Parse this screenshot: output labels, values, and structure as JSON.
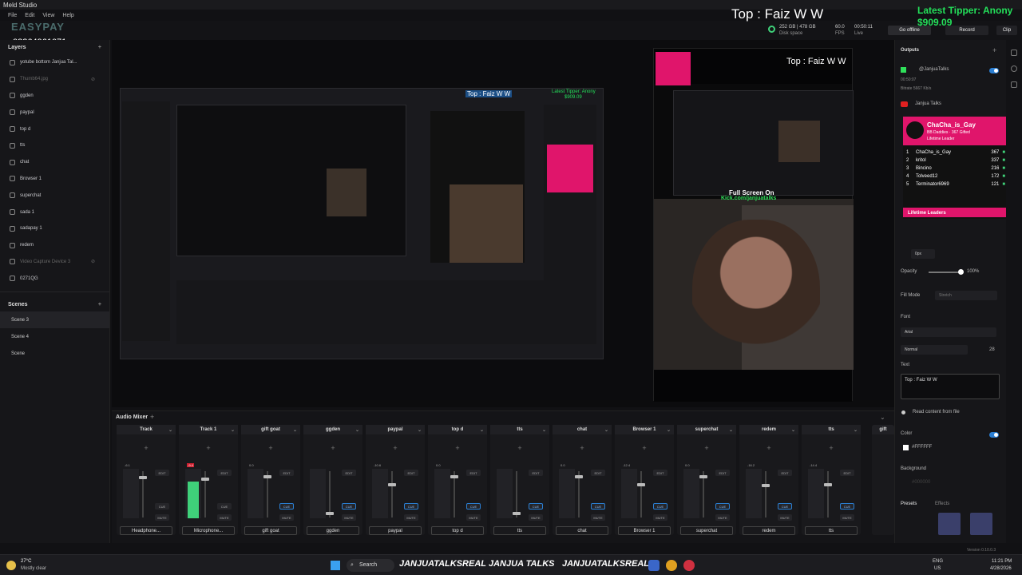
{
  "app": {
    "title": "Meld Studio",
    "menus": [
      "File",
      "Edit",
      "View",
      "Help"
    ],
    "phone": "03364961071",
    "logo": "EASYPAY"
  },
  "overlay": {
    "top_text": "Top : Faiz W W",
    "tipper_label": "Latest Tipper: Anony",
    "tipper_amount": "$909.09"
  },
  "topbar": {
    "disk": "252 GB | 478 GB",
    "disk_label": "Disk space",
    "fps": "60.0",
    "fps_label": "FPS",
    "time": "00:50:11",
    "time_label": "Live",
    "go_offline": "Go offline",
    "record": "Record",
    "clip": "Clip"
  },
  "layers": {
    "title": "Layers",
    "items": [
      {
        "name": "yotube bottom Janjua Tal...",
        "dim": false
      },
      {
        "name": "Thumb64.jpg",
        "dim": true
      },
      {
        "name": "ggden",
        "dim": false
      },
      {
        "name": "paypal",
        "dim": false
      },
      {
        "name": "top d",
        "dim": false
      },
      {
        "name": "tts",
        "dim": false
      },
      {
        "name": "chat",
        "dim": false
      },
      {
        "name": "Browser 1",
        "dim": false
      },
      {
        "name": "superchat",
        "dim": false
      },
      {
        "name": "sada 1",
        "dim": false
      },
      {
        "name": "sadapay 1",
        "dim": false
      },
      {
        "name": "redem",
        "dim": false
      },
      {
        "name": "Video Capture Device 3",
        "dim": true
      },
      {
        "name": "0271QG",
        "dim": false
      }
    ]
  },
  "scenes": {
    "title": "Scenes",
    "items": [
      "Scene 3",
      "Scene 4",
      "Scene"
    ]
  },
  "mixer": {
    "title": "Audio Mixer",
    "strips": [
      {
        "name": "Track",
        "src": "Headphone...",
        "db": "-6.1",
        "level": 0,
        "fader": 0.12,
        "cue": false
      },
      {
        "name": "Track 1",
        "src": "Microphone...",
        "db": "-9.4",
        "level": 0.75,
        "fader": 0.15,
        "cue": false
      },
      {
        "name": "gift goat",
        "src": "gift goat",
        "db": "0.0",
        "level": 0,
        "fader": 0.1,
        "cue": true
      },
      {
        "name": "ggden",
        "src": "ggden",
        "db": "",
        "level": 0,
        "fader": 0.95,
        "cue": true
      },
      {
        "name": "paypal",
        "src": "paypal",
        "db": "-10.6",
        "level": 0,
        "fader": 0.28,
        "cue": true
      },
      {
        "name": "top d",
        "src": "top d",
        "db": "0.0",
        "level": 0,
        "fader": 0.1,
        "cue": true
      },
      {
        "name": "tts",
        "src": "tts",
        "db": "",
        "level": 0,
        "fader": 0.95,
        "cue": true
      },
      {
        "name": "chat",
        "src": "chat",
        "db": "0.0",
        "level": 0,
        "fader": 0.1,
        "cue": true
      },
      {
        "name": "Browser 1",
        "src": "Browser 1",
        "db": "-12.4",
        "level": 0,
        "fader": 0.28,
        "cue": true
      },
      {
        "name": "superchat",
        "src": "superchat",
        "db": "0.0",
        "level": 0,
        "fader": 0.1,
        "cue": true
      },
      {
        "name": "redem",
        "src": "redem",
        "db": "-16.2",
        "level": 0,
        "fader": 0.3,
        "cue": true
      },
      {
        "name": "tts",
        "src": "tts",
        "db": "-14.4",
        "level": 0,
        "fader": 0.28,
        "cue": true
      }
    ],
    "partial": "gift",
    "edit": "EDIT",
    "cue": "CUE",
    "mute": "MUTE"
  },
  "outputs": {
    "title": "Outputs",
    "o1": "@JanjuaTalks",
    "o1_time": "00:50:07",
    "o1_bitrate": "Bitrate 5667 Kb/s",
    "o2": "Janjua Talks"
  },
  "leaderboard": {
    "top_name": "ChaCha_is_Gay",
    "top_sub": "BB Daddies · 367 Gifted",
    "top_sub2": "Lifetime Leader",
    "rows": [
      {
        "rank": "1",
        "name": "ChaCha_is_Gay",
        "val": "367"
      },
      {
        "rank": "2",
        "name": "kritol",
        "val": "337"
      },
      {
        "rank": "3",
        "name": "Bincino",
        "val": "216"
      },
      {
        "rank": "4",
        "name": "Tolveed12",
        "val": "172"
      },
      {
        "rank": "5",
        "name": "Terminator6969",
        "val": "121"
      }
    ],
    "footer": "Lifetime Leaders"
  },
  "props": {
    "pad": "0px",
    "opacity_label": "Opacity",
    "opacity": "100%",
    "opacity_value": 1.0,
    "fill_label": "Fill Mode",
    "fill": "Stretch",
    "font_label": "Font",
    "font": "Arial",
    "weight": "Normal",
    "size": "28",
    "text_label": "Text",
    "text": "Top : Faiz W W",
    "read_file": "Read content from file",
    "color_label": "Color",
    "color": "#FFFFFF",
    "bg_label": "Background",
    "bg": "#000000",
    "presets": "Presets",
    "effects": "Effects",
    "version": "Version 0.10.0.3"
  },
  "stream": {
    "fullscreen": "Full Screen On",
    "link": "Kick.com/janjuatalks",
    "handle1": "JANJUATALKSREAL",
    "handle2": "JANJUA TALKS",
    "handle3": "JANJUATALKSREAL"
  },
  "taskbar": {
    "weather_temp": "27°C",
    "weather_desc": "Mostly clear",
    "search": "Search",
    "lang": "ENG",
    "region": "US",
    "time": "11:21 PM",
    "date": "4/28/2026"
  },
  "colors": {
    "accent": "#2b7fd3",
    "pink": "#e0156b",
    "green": "#3fd17a",
    "tipper": "#24e05a"
  }
}
